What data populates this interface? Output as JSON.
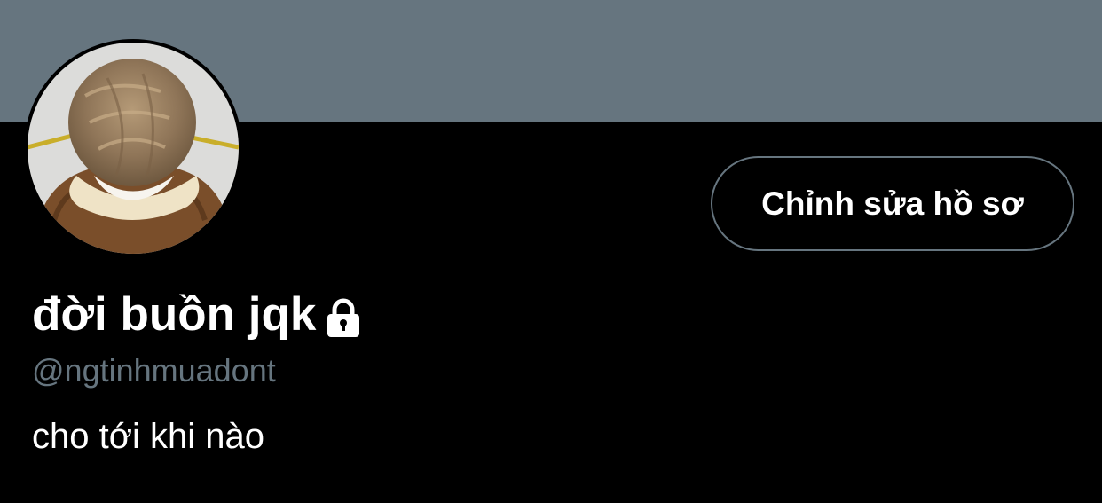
{
  "profile": {
    "display_name": "đời buồn jqk",
    "handle": "@ngtinhmuadont",
    "bio": "cho tới khi nào",
    "protected_icon": "lock-icon",
    "avatar_icon": "avatar-photo"
  },
  "actions": {
    "edit_profile_label": "Chỉnh sửa hồ sơ"
  },
  "colors": {
    "banner": "#66757f",
    "background": "#000000",
    "text_primary": "#ffffff",
    "text_secondary": "#66757f",
    "button_border": "#66757f"
  }
}
